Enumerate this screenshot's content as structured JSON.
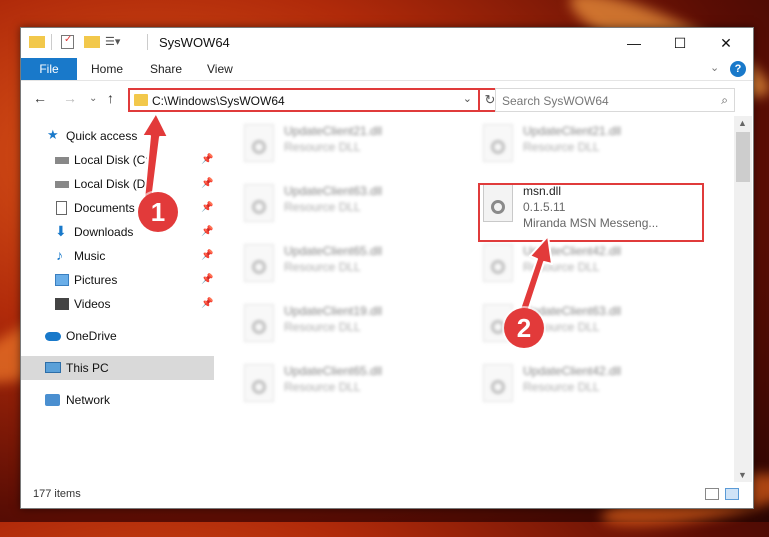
{
  "window": {
    "title": "SysWOW64",
    "minimize_glyph": "—",
    "maximize_glyph": "☐",
    "close_glyph": "✕"
  },
  "ribbon": {
    "file_tab": "File",
    "tabs": [
      "Home",
      "Share",
      "View"
    ]
  },
  "address": {
    "path": "C:\\Windows\\SysWOW64"
  },
  "search": {
    "placeholder": "Search SysWOW64"
  },
  "sidebar": {
    "items": [
      {
        "label": "Quick access",
        "icon": "star-icon",
        "pinned": false
      },
      {
        "label": "Local Disk (C:)",
        "icon": "drive-icon",
        "pinned": true
      },
      {
        "label": "Local Disk (D:)",
        "icon": "drive-icon",
        "pinned": true
      },
      {
        "label": "Documents",
        "icon": "document-icon",
        "pinned": true
      },
      {
        "label": "Downloads",
        "icon": "download-icon",
        "pinned": true
      },
      {
        "label": "Music",
        "icon": "music-icon",
        "pinned": true
      },
      {
        "label": "Pictures",
        "icon": "pictures-icon",
        "pinned": true
      },
      {
        "label": "Videos",
        "icon": "video-icon",
        "pinned": true
      },
      {
        "label": "OneDrive",
        "icon": "cloud-icon",
        "pinned": false
      },
      {
        "label": "This PC",
        "icon": "pc-icon",
        "pinned": false,
        "selected": true
      },
      {
        "label": "Network",
        "icon": "network-icon",
        "pinned": false
      }
    ]
  },
  "files": [
    {
      "name": "UpdateClient21.dll",
      "desc": "Resource DLL",
      "blur": true
    },
    {
      "name": "UpdateClient21.dll",
      "desc": "Resource DLL",
      "blur": true
    },
    {
      "name": "UpdateClient63.dll",
      "desc": "Resource DLL",
      "blur": true
    },
    {
      "name": "msn.dll",
      "desc": "0.1.5.11",
      "desc2": "Miranda MSN Messeng...",
      "blur": false
    },
    {
      "name": "UpdateClient65.dll",
      "desc": "Resource DLL",
      "blur": true
    },
    {
      "name": "UpdateClient42.dll",
      "desc": "Resource DLL",
      "blur": true
    },
    {
      "name": "UpdateClient19.dll",
      "desc": "Resource DLL",
      "blur": true
    },
    {
      "name": "UpdateClient63.dll",
      "desc": "Resource DLL",
      "blur": true
    },
    {
      "name": "UpdateClient65.dll",
      "desc": "Resource DLL",
      "blur": true
    },
    {
      "name": "UpdateClient42.dll",
      "desc": "Resource DLL",
      "blur": true
    }
  ],
  "status": {
    "item_count": "177 items"
  },
  "annotations": {
    "step1": "1",
    "step2": "2",
    "color": "#e23a3a"
  },
  "colors": {
    "accent": "#1979ca",
    "highlight": "#e03b3b"
  }
}
